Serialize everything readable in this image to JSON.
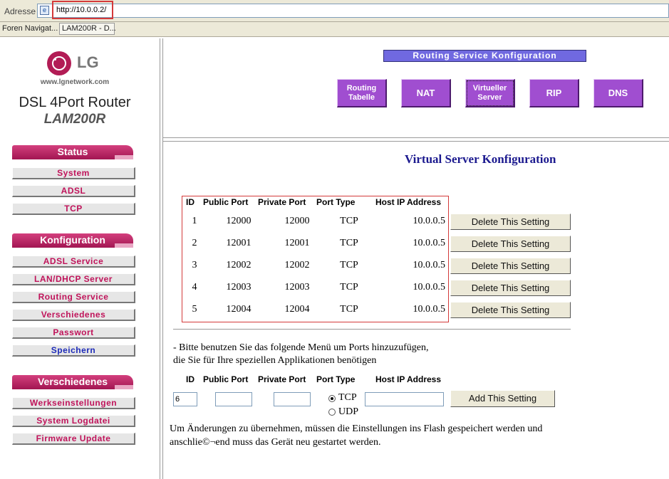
{
  "browser": {
    "address_label": "Adresse",
    "url": "http://10.0.0.2/",
    "tabs": [
      "Foren Navigat...",
      "LAM200R - D..."
    ]
  },
  "brand": {
    "logo_text": "LG",
    "website": "www.lgnetwork.com",
    "product": "DSL 4Port Router",
    "model": "LAM200R"
  },
  "sidebar": {
    "status_title": "Status",
    "status_items": [
      "System",
      "ADSL",
      "TCP"
    ],
    "config_title": "Konfiguration",
    "config_items": [
      "ADSL Service",
      "LAN/DHCP Server",
      "Routing Service",
      "Verschiedenes",
      "Passwort",
      "Speichern"
    ],
    "misc_title": "Verschiedenes",
    "misc_items": [
      "Werkseinstellungen",
      "System Logdatei",
      "Firmware Update"
    ]
  },
  "routing": {
    "title": "Routing Service Konfiguration",
    "buttons": [
      "Routing Tabelle",
      "NAT",
      "Virtueller Server",
      "RIP",
      "DNS"
    ]
  },
  "main": {
    "title": "Virtual Server Konfiguration",
    "headers": [
      "ID",
      "Public Port",
      "Private Port",
      "Port Type",
      "Host IP Address"
    ],
    "rows": [
      {
        "id": "1",
        "public": "12000",
        "private": "12000",
        "type": "TCP",
        "ip": "10.0.0.5"
      },
      {
        "id": "2",
        "public": "12001",
        "private": "12001",
        "type": "TCP",
        "ip": "10.0.0.5"
      },
      {
        "id": "3",
        "public": "12002",
        "private": "12002",
        "type": "TCP",
        "ip": "10.0.0.5"
      },
      {
        "id": "4",
        "public": "12003",
        "private": "12003",
        "type": "TCP",
        "ip": "10.0.0.5"
      },
      {
        "id": "5",
        "public": "12004",
        "private": "12004",
        "type": "TCP",
        "ip": "10.0.0.5"
      }
    ],
    "delete_label": "Delete This Setting",
    "info_line1": "- Bitte benutzen Sie das folgende Menü um Ports hinzuzufügen,",
    "info_line2": "die Sie für Ihre speziellen Applikationen benötigen",
    "form": {
      "id_value": "6",
      "public_value": "",
      "private_value": "",
      "ip_value": "",
      "type_tcp": "TCP",
      "type_udp": "UDP",
      "selected_type": "TCP",
      "add_label": "Add This Setting"
    },
    "note_line1": "Um Änderungen zu übernehmen, müssen die Einstellungen ins Flash gespeichert werden und",
    "note_line2": "anschlie©¬end muss das Gerät neu gestartet werden."
  }
}
